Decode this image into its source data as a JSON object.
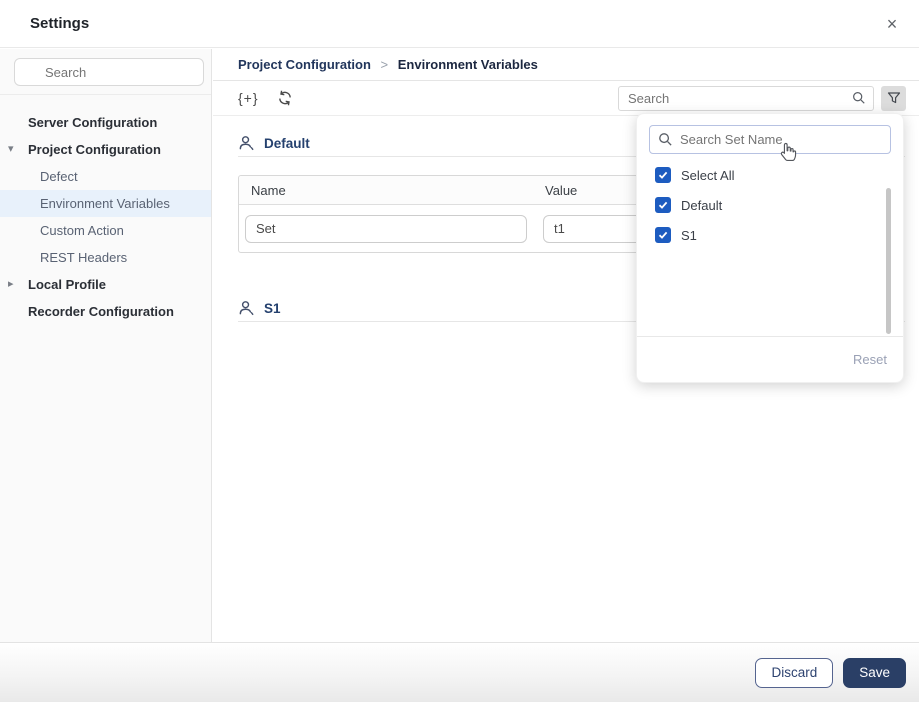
{
  "window": {
    "title": "Settings",
    "close_icon": "×"
  },
  "sidebar": {
    "search_placeholder": "Search",
    "caret_down": "▾",
    "caret_right": "▸",
    "items": [
      {
        "label": "Server Configuration"
      },
      {
        "label": "Project Configuration"
      },
      {
        "label": "Defect"
      },
      {
        "label": "Environment Variables"
      },
      {
        "label": "Custom Action"
      },
      {
        "label": "REST Headers"
      },
      {
        "label": "Local Profile"
      },
      {
        "label": "Recorder Configuration"
      }
    ]
  },
  "breadcrumb": {
    "parent": "Project Configuration",
    "separator": ">",
    "current": "Environment Variables"
  },
  "toolbar": {
    "add_set_icon": "{+}",
    "search_placeholder": "Search"
  },
  "filter_popover": {
    "search_placeholder": "Search Set Name",
    "options": [
      {
        "label": "Select All",
        "checked": true
      },
      {
        "label": "Default",
        "checked": true
      },
      {
        "label": "S1",
        "checked": true
      }
    ],
    "reset_label": "Reset"
  },
  "sections": [
    {
      "title": "Default",
      "table": {
        "headers": [
          "Name",
          "Value"
        ],
        "rows": [
          {
            "name": "Set",
            "value": "t1"
          }
        ]
      }
    },
    {
      "title": "S1"
    }
  ],
  "footer": {
    "discard_label": "Discard",
    "save_label": "Save"
  },
  "colors": {
    "accent_navy": "#2a3f66",
    "checkbox_blue": "#1d5cc0",
    "selected_item_bg": "#e8f1fb"
  }
}
